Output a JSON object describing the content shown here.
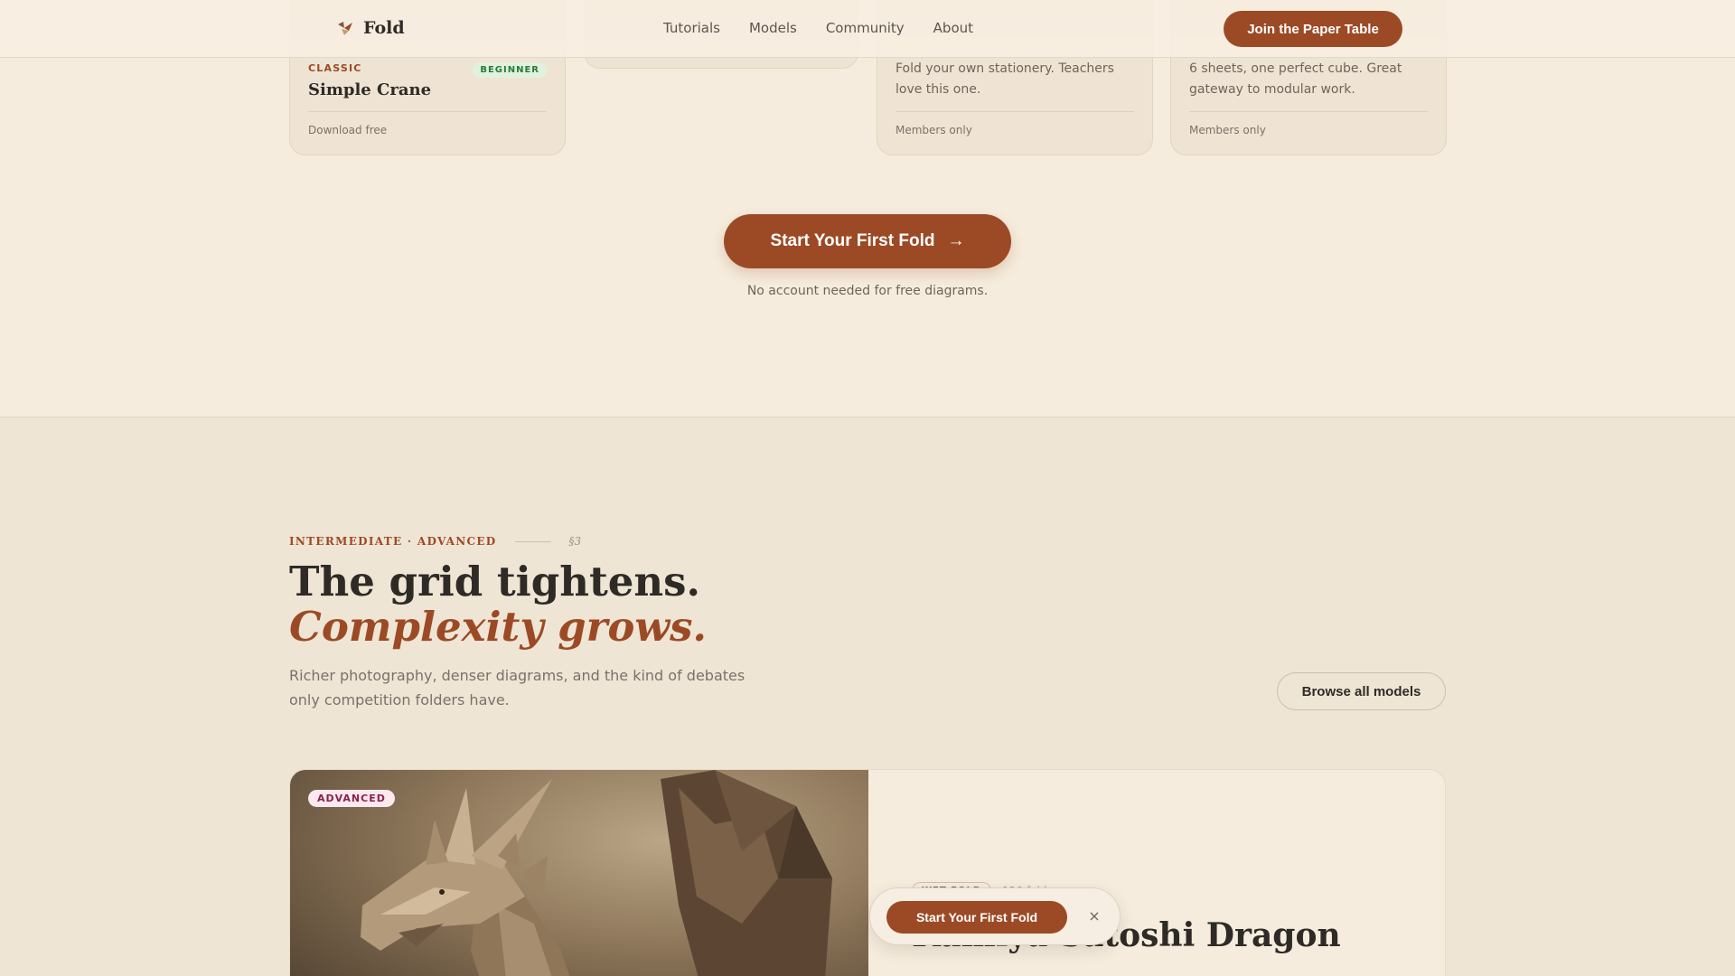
{
  "nav": {
    "brand": "Fold",
    "links": [
      "Tutorials",
      "Models",
      "Community",
      "About"
    ],
    "join_label": "Join the Paper Table"
  },
  "cards": [
    {
      "tag": "CLASSIC",
      "title": "Simple Crane",
      "level": "BEGINNER",
      "footer": "Download free"
    },
    {
      "description": "Fold your own stationery. Teachers love this one.",
      "footer": "Members only"
    },
    {
      "description": "6 sheets, one perfect cube. Great gateway to modular work.",
      "footer": "Members only"
    }
  ],
  "cta": {
    "label": "Start Your First Fold",
    "arrow": "→",
    "note": "No account needed for free diagrams."
  },
  "section": {
    "eyebrow": "INTERMEDIATE · ADVANCED",
    "number": "§3",
    "heading_line1": "The grid tightens.",
    "heading_line2": "Complexity grows.",
    "subtext": "Richer photography, denser diagrams, and the kind of debates only competition folders have.",
    "browse_label": "Browse all models"
  },
  "feature": {
    "badge": "ADVANCED",
    "pill": "WET FOLD",
    "count": "120 folds",
    "title": "Kamiya Satoshi Dragon"
  },
  "toast": {
    "label": "Start Your First Fold",
    "close": "×"
  },
  "colors": {
    "accent": "#9c4a25",
    "background": "#f5ecdd",
    "section_background": "#efe5d5"
  }
}
